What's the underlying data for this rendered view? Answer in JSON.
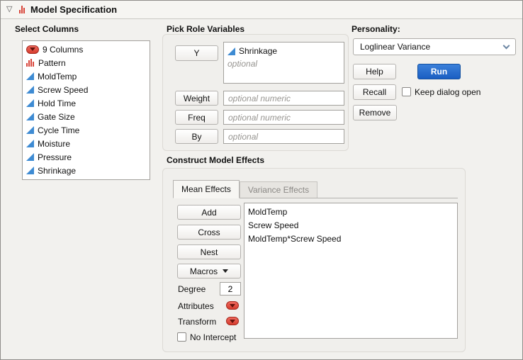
{
  "titlebar": {
    "title": "Model Specification"
  },
  "select_columns": {
    "heading": "Select Columns",
    "count_label": "9 Columns",
    "items": [
      {
        "label": "Pattern",
        "icon": "histogram-icon"
      },
      {
        "label": "MoldTemp",
        "icon": "continuous-icon"
      },
      {
        "label": "Screw Speed",
        "icon": "continuous-icon"
      },
      {
        "label": "Hold Time",
        "icon": "continuous-icon"
      },
      {
        "label": "Gate Size",
        "icon": "continuous-icon"
      },
      {
        "label": "Cycle Time",
        "icon": "continuous-icon"
      },
      {
        "label": "Moisture",
        "icon": "continuous-icon"
      },
      {
        "label": "Pressure",
        "icon": "continuous-icon"
      },
      {
        "label": "Shrinkage",
        "icon": "continuous-icon"
      }
    ]
  },
  "roles": {
    "heading": "Pick Role Variables",
    "y_button": "Y",
    "y_value": "Shrinkage",
    "y_placeholder": "optional",
    "weight_button": "Weight",
    "weight_placeholder": "optional numeric",
    "freq_button": "Freq",
    "freq_placeholder": "optional numeric",
    "by_button": "By",
    "by_placeholder": "optional"
  },
  "personality": {
    "heading": "Personality:",
    "selected": "Loglinear Variance",
    "help_button": "Help",
    "run_button": "Run",
    "recall_button": "Recall",
    "keep_dialog_label": "Keep dialog open",
    "remove_button": "Remove"
  },
  "effects": {
    "heading": "Construct Model Effects",
    "tabs": [
      {
        "label": "Mean Effects",
        "active": true
      },
      {
        "label": "Variance Effects",
        "active": false
      }
    ],
    "add_button": "Add",
    "cross_button": "Cross",
    "nest_button": "Nest",
    "macros_button": "Macros",
    "degree_label": "Degree",
    "degree_value": "2",
    "attributes_label": "Attributes",
    "transform_label": "Transform",
    "no_intercept_label": "No Intercept",
    "items": [
      "MoldTemp",
      "Screw Speed",
      "MoldTemp*Screw Speed"
    ]
  },
  "colors": {
    "run_blue": "#1a5ec2",
    "red_triangle": "#d63c2e",
    "continuous_blue": "#3e8bd3",
    "histogram_red": "#d8453a"
  }
}
